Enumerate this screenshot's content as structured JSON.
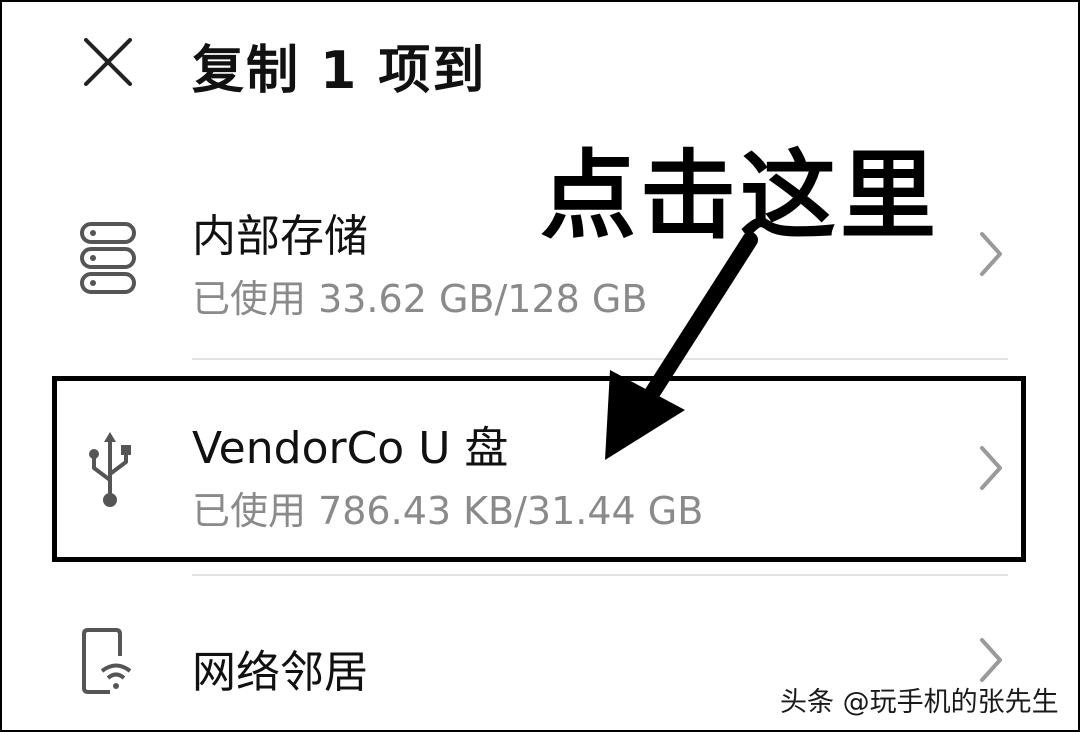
{
  "header": {
    "title": "复制 1 项到",
    "close_icon": "close-icon"
  },
  "locations": [
    {
      "name": "内部存储",
      "usage": "已使用 33.62 GB/128 GB",
      "icon": "storage-icon"
    },
    {
      "name": "VendorCo U 盘",
      "usage": "已使用 786.43 KB/31.44 GB",
      "icon": "usb-icon"
    },
    {
      "name": "网络邻居",
      "usage": "",
      "icon": "network-device-icon"
    }
  ],
  "annotation": {
    "text": "点击这里"
  },
  "watermark": {
    "text": "头条 @玩手机的张先生"
  },
  "colors": {
    "primary_text": "#111111",
    "secondary_text": "#8a8a8a",
    "divider": "#e2e2e2",
    "chevron": "#9a9a9a",
    "icon": "#555555"
  }
}
